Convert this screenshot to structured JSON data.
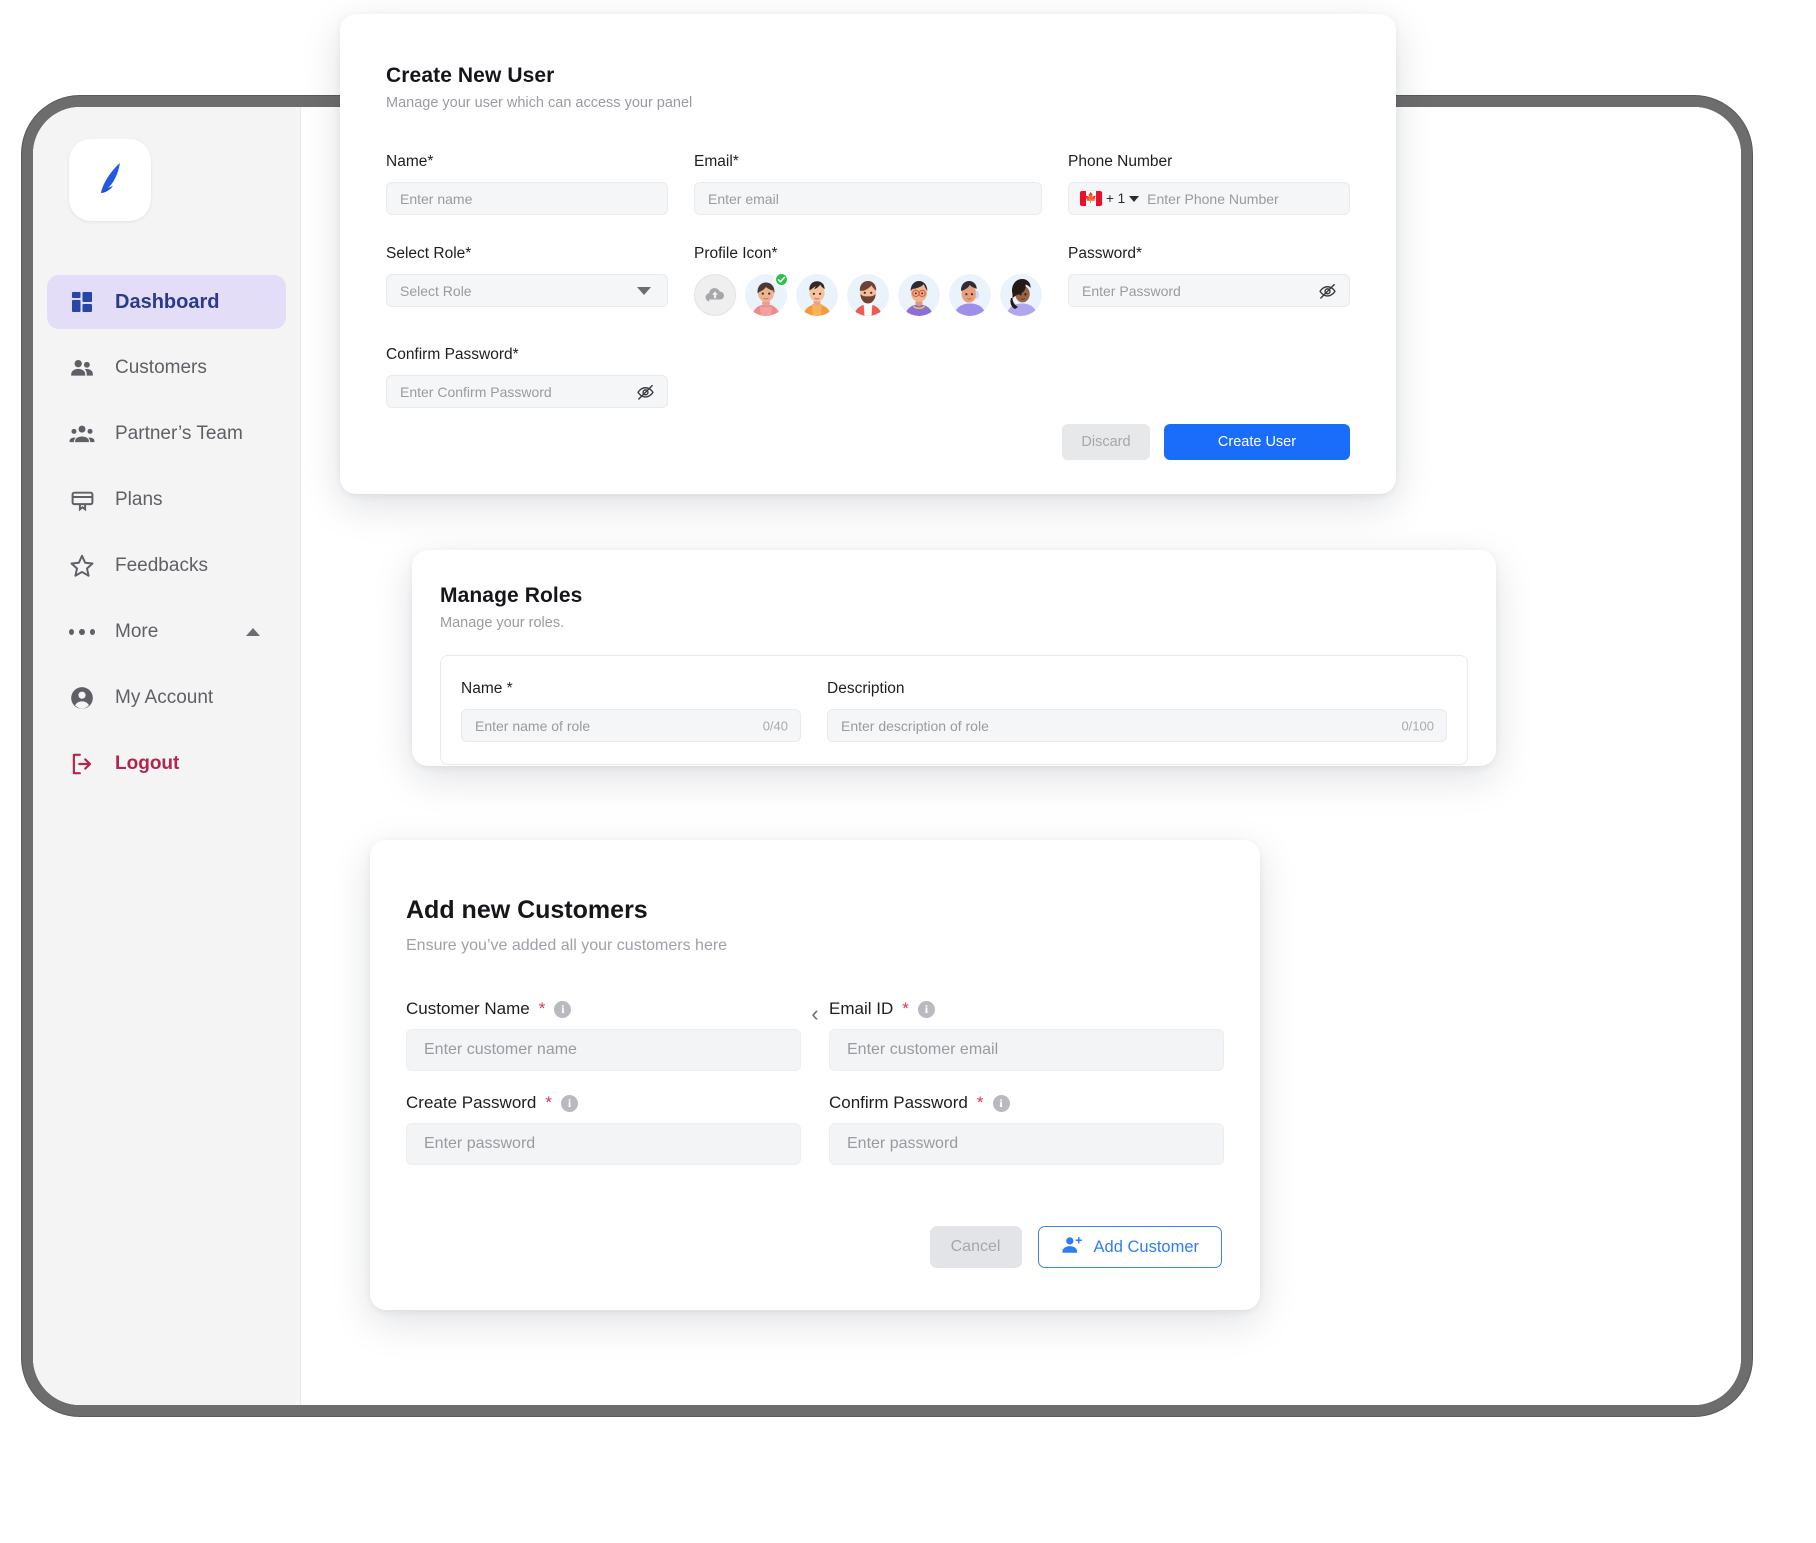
{
  "sidebar": {
    "logo_icon": "bird-logo-icon",
    "items": [
      {
        "label": "Dashboard",
        "icon": "dashboard-grid-icon",
        "active": true
      },
      {
        "label": "Customers",
        "icon": "people-icon",
        "active": false
      },
      {
        "label": "Partner’s Team",
        "icon": "group-icon",
        "active": false
      },
      {
        "label": "Plans",
        "icon": "card-plan-icon",
        "active": false
      },
      {
        "label": "Feedbacks",
        "icon": "star-icon",
        "active": false
      },
      {
        "label": "More",
        "icon": "ellipsis-icon",
        "active": false,
        "caret": "chevron-up-icon"
      },
      {
        "label": "My Account",
        "icon": "account-circle-icon",
        "active": false
      },
      {
        "label": "Logout",
        "icon": "logout-icon",
        "active": false
      }
    ],
    "active_color": "#2b3a8f",
    "active_bg": "#e3ddf7",
    "logout_color": "#b3254a"
  },
  "create_user": {
    "title": "Create New User",
    "subtitle": "Manage your user which can access your panel",
    "fields": {
      "name": {
        "label": "Name*",
        "placeholder": "Enter name"
      },
      "email": {
        "label": "Email*",
        "placeholder": "Enter email"
      },
      "phone": {
        "label": "Phone Number",
        "placeholder": "Enter Phone Number",
        "country_code": "+ 1",
        "flag": "canada-flag-icon"
      },
      "role": {
        "label": "Select Role*",
        "placeholder": "Select Role"
      },
      "profile_icon": {
        "label": "Profile Icon*",
        "upload_icon": "cloud-upload-icon",
        "selected_index": 1,
        "count": 7
      },
      "password": {
        "label": "Password*",
        "placeholder": "Enter Password",
        "toggle_icon": "eye-off-icon"
      },
      "confirm_password": {
        "label": "Confirm Password*",
        "placeholder": "Enter Confirm Password",
        "toggle_icon": "eye-off-icon"
      }
    },
    "buttons": {
      "discard": "Discard",
      "create": "Create User"
    },
    "primary_color": "#1a6dfb"
  },
  "manage_roles": {
    "title": "Manage Roles",
    "subtitle": "Manage your roles.",
    "name": {
      "label": "Name *",
      "placeholder": "Enter name of role",
      "counter": "0/40"
    },
    "description": {
      "label": "Description",
      "placeholder": "Enter description of role",
      "counter": "0/100"
    }
  },
  "add_customers": {
    "title": "Add new Customers",
    "subtitle": "Ensure you’ve added all your customers here",
    "collapse_icon": "chevron-left-icon",
    "fields": {
      "customer_name": {
        "label": "Customer Name",
        "required": "*",
        "placeholder": "Enter customer name",
        "info_icon": "info-icon"
      },
      "email_id": {
        "label": "Email ID",
        "required": "*",
        "placeholder": "Enter customer email",
        "info_icon": "info-icon"
      },
      "create_password": {
        "label": "Create Password",
        "required": "*",
        "placeholder": "Enter password",
        "info_icon": "info-icon"
      },
      "confirm_password": {
        "label": "Confirm Password",
        "required": "*",
        "placeholder": "Enter password",
        "info_icon": "info-icon"
      }
    },
    "buttons": {
      "cancel": "Cancel",
      "add": "Add Customer",
      "add_icon": "person-add-icon"
    },
    "accent_color": "#2f7df4"
  }
}
